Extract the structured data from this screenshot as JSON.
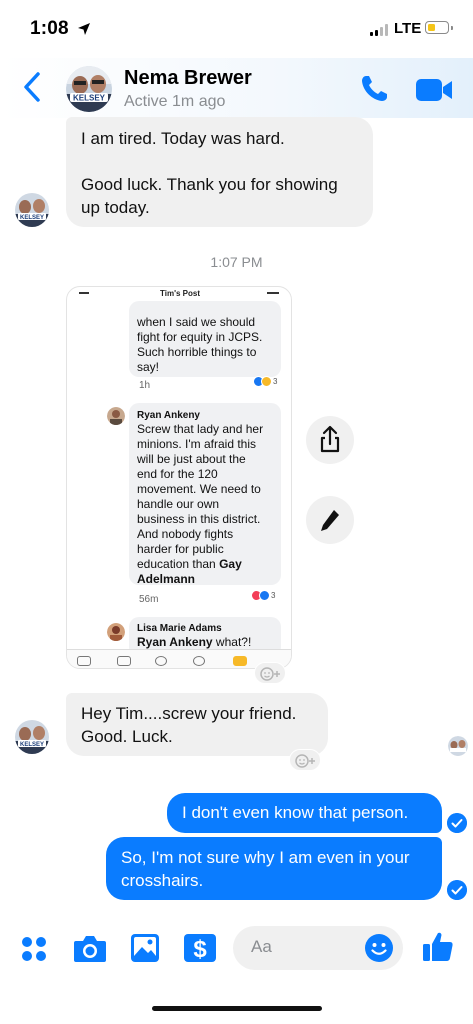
{
  "status": {
    "time": "1:08",
    "network": "LTE",
    "battery_level": 0.4
  },
  "header": {
    "name": "Nema Brewer",
    "status": "Active 1m ago",
    "avatar_caption": "KELSEY",
    "accent": "#0a7cff"
  },
  "messages": {
    "in1_line1": "I am tired. Today was hard.",
    "in1_line2": "Good luck. Thank you for showing",
    "in1_line3": "up today.",
    "timestamp": "1:07 PM",
    "in2_line1": "Hey Tim....screw your friend.",
    "in2_line2": "Good. Luck.",
    "out1": "I don't even know that person.",
    "out2_line1": "So, I'm not sure why I am even in your",
    "out2_line2": "crosshairs."
  },
  "shared_post": {
    "title": "Tim's Post",
    "c1_line1": "when I said we should",
    "c1_line2": "fight for equity in JCPS.",
    "c1_line3": "Such horrible things to",
    "c1_line4": "say!",
    "c1_time": "1h",
    "c1_react_count": "3",
    "c2_name": "Ryan Ankeny",
    "c2_lines": [
      "Screw that lady and her",
      "minions. I'm afraid this",
      "will be just about the",
      "end for the 120",
      "movement. We need to",
      "handle our own",
      "business in this district.",
      "And nobody fights",
      "harder for public"
    ],
    "c2_last_pre": "education than ",
    "c2_last_bold": "Gay",
    "c2_last_line": "Adelmann",
    "c2_time": "56m",
    "c2_react_count": "3",
    "c3_name": "Lisa Marie Adams",
    "c3_mention": "Ryan Ankeny",
    "c3_text": " what?!"
  },
  "composer": {
    "placeholder": "Aa"
  },
  "icons": {
    "back": "chevron-left-icon",
    "call": "phone-icon",
    "video": "video-camera-icon",
    "share": "share-icon",
    "edit": "pencil-icon",
    "apps": "four-dots-icon",
    "camera": "camera-icon",
    "gallery": "image-icon",
    "payment": "dollar-icon",
    "emoji": "smiley-icon",
    "like": "thumbs-up-icon"
  }
}
